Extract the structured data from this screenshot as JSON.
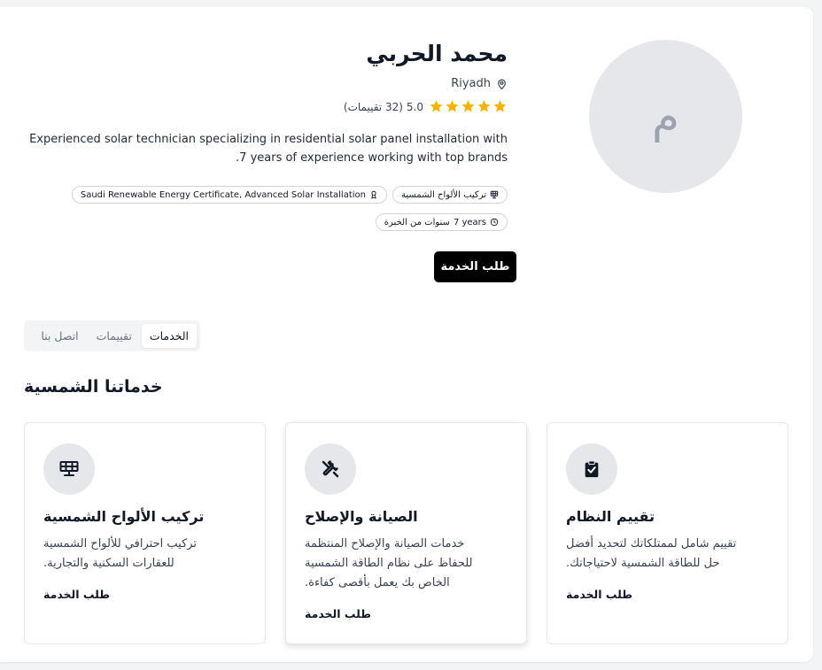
{
  "profile": {
    "avatar_initial": "م",
    "name": "محمد الحربي",
    "location": "Riyadh",
    "rating_value": "5.0",
    "rating_count": "(32 تقييمات)",
    "stars": 5,
    "bio": "Experienced solar technician specializing in residential solar panel installation with 7 years of experience working with top brands."
  },
  "tags": {
    "specialty": "تركيب الألواح الشمسية",
    "certificates": "Saudi Renewable Energy Certificate, Advanced Solar Installation",
    "experience_years": "7 years",
    "experience_label": "سنوات من الخبرة"
  },
  "actions": {
    "request_service": "طلب الخدمة"
  },
  "tabs": [
    {
      "label": "الخدمات",
      "active": true
    },
    {
      "label": "تقييمات",
      "active": false
    },
    {
      "label": "اتصل بنا",
      "active": false
    }
  ],
  "services_section": {
    "title": "خدماتنا الشمسية",
    "cards": [
      {
        "icon": "solar-panel-icon",
        "title": "تركيب الألواح الشمسية",
        "description": "تركيب احترافي للألواح الشمسية للعقارات السكنية والتجارية.",
        "link": "طلب الخدمة"
      },
      {
        "icon": "tools-icon",
        "title": "الصيانة والإصلاح",
        "description": "خدمات الصيانة والإصلاح المنتظمة للحفاظ على نظام الطاقة الشمسية الخاص بك يعمل بأقصى كفاءة.",
        "link": "طلب الخدمة"
      },
      {
        "icon": "clipboard-check-icon",
        "title": "تقييم النظام",
        "description": "تقييم شامل لممتلكاتك لتحديد أفضل حل للطاقة الشمسية لاحتياجاتك.",
        "link": "طلب الخدمة"
      }
    ]
  },
  "colors": {
    "star": "#f4b400",
    "button_bg": "#000000",
    "avatar_bg": "#e5e7eb"
  }
}
